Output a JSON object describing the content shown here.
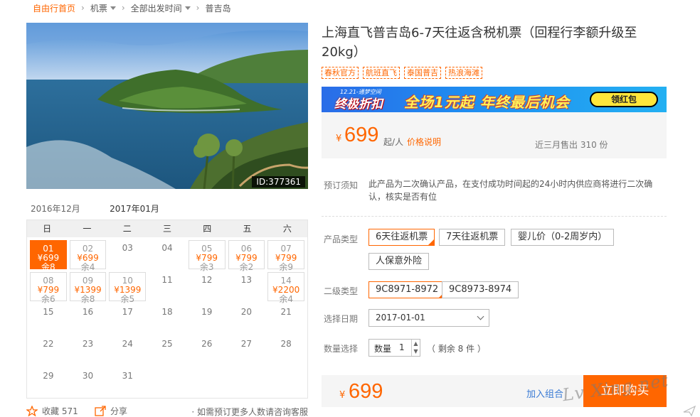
{
  "breadcrumb": [
    "自由行首页",
    "机票",
    "全部出发时间",
    "普吉岛"
  ],
  "hero": {
    "id_badge": "ID:377361"
  },
  "calendar": {
    "tabs": {
      "prev": "2016年12月",
      "current": "2017年01月"
    },
    "weekdays": [
      "日",
      "一",
      "二",
      "三",
      "四",
      "五",
      "六"
    ],
    "cells": [
      {
        "day": "01",
        "price": "¥699",
        "remain": "余8",
        "selected": true
      },
      {
        "day": "02",
        "price": "¥699",
        "remain": "余4"
      },
      {
        "day": "03"
      },
      {
        "day": "04"
      },
      {
        "day": "05",
        "price": "¥799",
        "remain": "余3"
      },
      {
        "day": "06",
        "price": "¥799",
        "remain": "余2"
      },
      {
        "day": "07",
        "price": "¥799",
        "remain": "余9"
      },
      {
        "day": "08",
        "price": "¥799",
        "remain": "余6"
      },
      {
        "day": "09",
        "price": "¥1399",
        "remain": "余8"
      },
      {
        "day": "10",
        "price": "¥1399",
        "remain": "余5"
      },
      {
        "day": "11"
      },
      {
        "day": "12"
      },
      {
        "day": "13"
      },
      {
        "day": "14",
        "price": "¥2200",
        "remain": "余4"
      },
      {
        "day": "15"
      },
      {
        "day": "16"
      },
      {
        "day": "17"
      },
      {
        "day": "18"
      },
      {
        "day": "19"
      },
      {
        "day": "20"
      },
      {
        "day": "21"
      },
      {
        "day": "22"
      },
      {
        "day": "23"
      },
      {
        "day": "24"
      },
      {
        "day": "25"
      },
      {
        "day": "26"
      },
      {
        "day": "27"
      },
      {
        "day": "28"
      },
      {
        "day": "29"
      },
      {
        "day": "30"
      },
      {
        "day": "31"
      }
    ]
  },
  "actions": {
    "favorite_label": "收藏 571",
    "share_label": "分享",
    "consult_text": "· 如需预订更多人数请咨询客服"
  },
  "product": {
    "title": "上海直飞普吉岛6-7天往返含税机票（回程行李额升级至20kg）",
    "tags": [
      "春秋官方",
      "航班直飞",
      "泰国普吉",
      "热浪海滩"
    ],
    "banner": {
      "small": "12.21-通梦空间",
      "badge": "终极折扣",
      "main": "全场1元起 年终最后机会",
      "button": "领红包"
    },
    "price": {
      "currency": "¥",
      "value": "699",
      "unit": "起/人",
      "explain": "价格说明",
      "sold": "近三月售出 310 份"
    },
    "notice": {
      "label": "预订须知",
      "text": "此产品为二次确认产品，在支付成功时间起的24小时内供应商将进行二次确认，核实是否有位"
    },
    "type": {
      "label": "产品类型",
      "options": [
        "6天往返机票",
        "7天往返机票",
        "婴儿价（0-2周岁内）",
        "人保意外险"
      ]
    },
    "subtype": {
      "label": "二级类型",
      "options": [
        "9C8971-8972",
        "9C8973-8974"
      ]
    },
    "date": {
      "label": "选择日期",
      "value": "2017-01-01"
    },
    "quantity": {
      "label": "数量选择",
      "field_label": "数量",
      "value": "1",
      "remain": "（ 剩余 8 件 ）"
    },
    "buy": {
      "currency": "¥",
      "value": "699",
      "combo": "加入组合",
      "button": "立即购买"
    }
  },
  "watermark": "Lv Xing.net",
  "colors": {
    "accent": "#ff6600",
    "link": "#3a7bd5"
  }
}
